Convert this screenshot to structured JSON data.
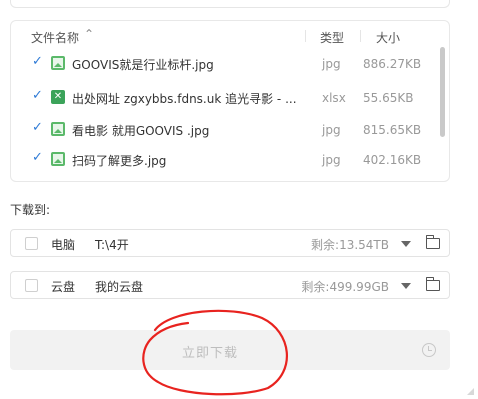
{
  "file_list": {
    "header": {
      "name_label": "文件名称",
      "sort_icon": "⌃",
      "type_label": "类型",
      "size_label": "大小"
    },
    "rows": [
      {
        "checked": true,
        "icon": "image-file-icon",
        "name": "GOOVIS就是行业标杆.jpg",
        "type": "jpg",
        "size": "886.27KB"
      },
      {
        "checked": true,
        "icon": "excel-file-icon",
        "name": "出处网址 zgxybbs.fdns.uk 追光寻影 - ...",
        "type": "xlsx",
        "size": "55.65KB"
      },
      {
        "checked": true,
        "icon": "image-file-icon",
        "name": "看电影 就用GOOVIS .jpg",
        "type": "jpg",
        "size": "815.65KB"
      },
      {
        "checked": true,
        "icon": "image-file-icon",
        "name": "扫码了解更多.jpg",
        "type": "jpg",
        "size": "402.16KB"
      }
    ]
  },
  "download_to": {
    "label": "下载到:",
    "targets": [
      {
        "name": "电脑",
        "path": "T:\\4开",
        "free": "剩余:13.54TB",
        "checked": false
      },
      {
        "name": "云盘",
        "path": "我的云盘",
        "free": "剩余:499.99GB",
        "checked": false
      }
    ]
  },
  "download_button": {
    "label": "立即下载",
    "enabled": false
  },
  "colors": {
    "check_blue": "#2f7bd6",
    "image_icon_green": "#5bb96a",
    "excel_icon_green": "#3ba35a",
    "annotation_red": "#e8231f"
  }
}
